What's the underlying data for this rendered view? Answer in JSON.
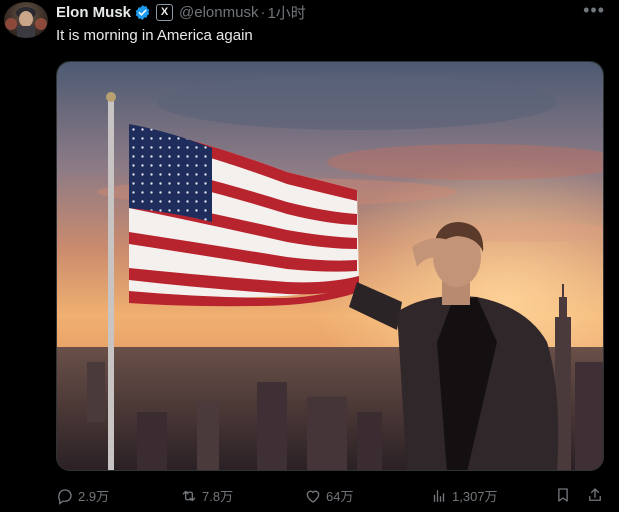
{
  "tweet": {
    "author_name": "Elon Musk",
    "x_badge": "X",
    "handle": "@elonmusk",
    "separator": "·",
    "time": "1小时",
    "more": "•••",
    "text": "It is morning in America again"
  },
  "actions": {
    "replies": "2.9万",
    "reposts": "7.8万",
    "likes": "64万",
    "views": "1,307万"
  },
  "icons": {
    "verified": "verified-badge-icon",
    "reply": "reply-icon",
    "repost": "repost-icon",
    "like": "heart-icon",
    "views": "views-chart-icon",
    "bookmark": "bookmark-icon",
    "share": "share-icon"
  },
  "colors": {
    "background": "#000000",
    "primary_text": "#e7e9ea",
    "secondary_text": "#71767b",
    "verified_blue": "#1d9bf0"
  }
}
